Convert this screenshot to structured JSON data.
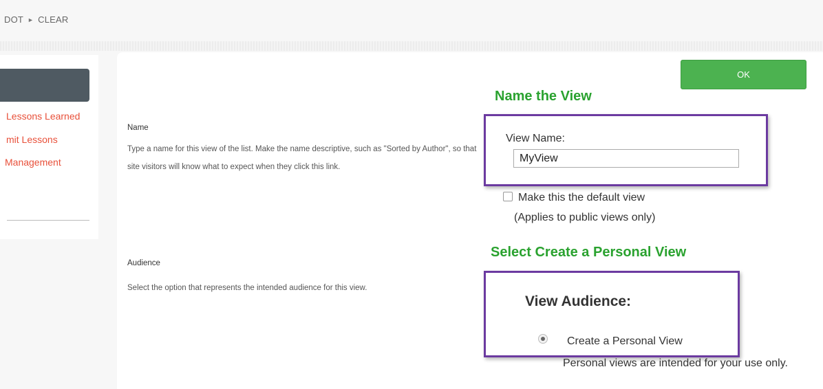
{
  "breadcrumb": {
    "item1": "DOT",
    "item2": "CLEAR",
    "separator": "►"
  },
  "sidebar": {
    "links": [
      "Lessons Learned",
      "mit Lessons",
      "Management"
    ]
  },
  "toolbar": {
    "ok_label": "OK"
  },
  "name_section": {
    "title": "Name",
    "description": "Type a name for this view of the list. Make the name descriptive, such as \"Sorted by Author\", so that site visitors will know what to expect when they click this link."
  },
  "audience_section": {
    "title": "Audience",
    "description": "Select the option that represents the intended audience for this view."
  },
  "annotations": {
    "name_heading": "Name the View",
    "audience_heading": "Select Create a Personal View"
  },
  "view_name": {
    "label": "View Name:",
    "value": "MyView"
  },
  "default_view": {
    "label": "Make this the default view",
    "note": "(Applies to public views only)",
    "checked": false
  },
  "view_audience": {
    "heading": "View Audience:",
    "option_label": "Create a Personal View",
    "option_note": "Personal views are intended for your use only.",
    "selected": true
  },
  "colors": {
    "accent": "#4cb250",
    "annotation_green": "#2aa22f",
    "highlight_purple": "#6b3aa0",
    "link_red": "#e8503a"
  }
}
